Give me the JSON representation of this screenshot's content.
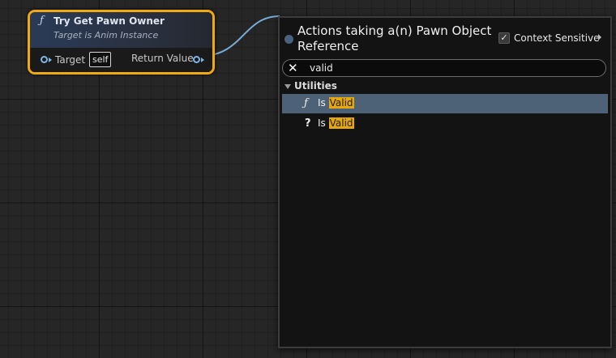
{
  "node": {
    "title": "Try Get Pawn Owner",
    "subtitle": "Target is Anim Instance",
    "target_label": "Target",
    "target_value": "self",
    "return_label": "Return Value",
    "border_color": "#f0a912"
  },
  "panel": {
    "title": "Actions taking a(n) Pawn Object Reference",
    "context_sensitive_label": "Context Sensitive",
    "context_sensitive_checked": true,
    "search_value": "valid",
    "category": "Utilities",
    "items": [
      {
        "icon": "function-icon",
        "prefix": "Is ",
        "match": "Valid",
        "selected": true
      },
      {
        "icon": "question-icon",
        "prefix": "Is ",
        "match": "Valid",
        "selected": false
      }
    ]
  },
  "icons": {
    "function_glyph": "ƒ",
    "question_glyph": "?",
    "clear_glyph": "✕",
    "check_glyph": "✓"
  },
  "colors": {
    "highlight": "#e6a80d",
    "selection": "#4e6277",
    "pin": "#7eb7e6"
  }
}
